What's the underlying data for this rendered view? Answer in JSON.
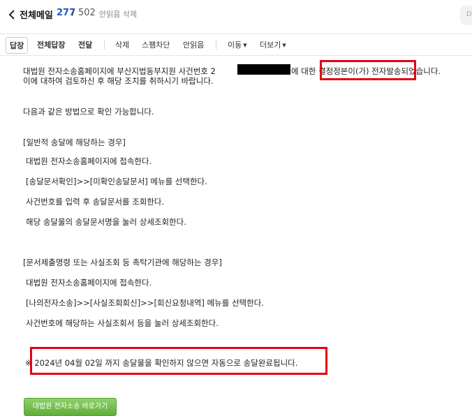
{
  "header": {
    "title": "전체메일",
    "count_current": "277",
    "count_separator": "/",
    "count_total": "502",
    "delete_unread": "안읽음 삭제",
    "right_button": "D"
  },
  "toolbar": {
    "reply": "답장",
    "reply_all": "전체답장",
    "forward": "전달",
    "delete": "삭제",
    "block_spam": "스팸차단",
    "mark_unread": "안읽음",
    "move": "이동",
    "more": "더보기"
  },
  "message": {
    "intro_part1": "대법원 전자소송홈페이지에 부산지법동부지원 사건번호 2",
    "intro_part2": "에 대한 ",
    "intro_highlight": "결정정본이(가) 전자발송",
    "intro_part3": "되었습니다.",
    "intro_line2": "이에 대하여 검토하신 후 해당 조치를 취하시기 바랍니다.",
    "methods_intro": "다음과 같은 방법으로 확인 가능합니다.",
    "section1_title": "[일반적 송달에 해당하는 경우]",
    "section1_steps": [
      "대법원 전자소송홈페이지에 접속한다.",
      "[송달문서확인]>>[미확인송달문서] 메뉴를 선택한다.",
      "사건번호를 입력 후 송달문서를 조회한다.",
      "해당 송달물의 송달문서명을 눌러 상세조회한다."
    ],
    "section2_title": "[문서제출명령 또는 사실조회 등 촉탁기관에 해당하는 경우]",
    "section2_steps": [
      "대법원 전자소송홈페이지에 접속한다.",
      "[나의전자소송]>>[사실조회회신]>>[회신요청내역] 메뉴를 선택한다.",
      "사건번호에 해당하는 사실조회서 등을 눌러 상세조회한다."
    ],
    "notice": "※ 2024년 04월 02일 까지 송달물을 확인하지 않으면 자동으로 송달완료됩니다.",
    "court_button": "대법원 전자소송 바로가기"
  }
}
